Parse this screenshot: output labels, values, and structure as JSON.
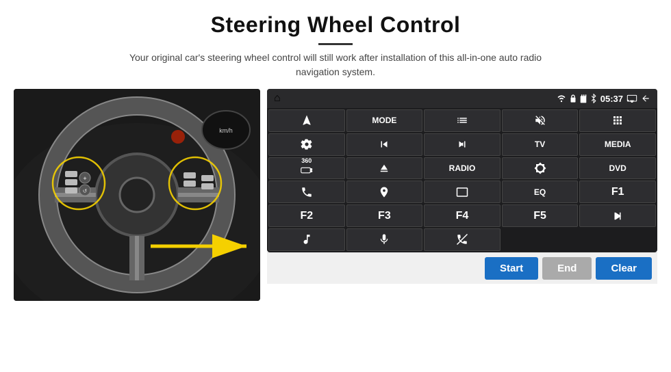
{
  "header": {
    "title": "Steering Wheel Control",
    "description": "Your original car's steering wheel control will still work after installation of this all-in-one auto radio navigation system."
  },
  "status_bar": {
    "home_icon": "⌂",
    "wifi_icon": "wifi",
    "lock_icon": "lock",
    "sd_icon": "sd",
    "bt_icon": "bt",
    "time": "05:37",
    "cast_icon": "cast",
    "back_icon": "back"
  },
  "buttons": [
    {
      "id": "nav",
      "type": "icon",
      "icon": "nav",
      "row": 1,
      "col": 1
    },
    {
      "id": "mode",
      "type": "text",
      "label": "MODE",
      "row": 1,
      "col": 2
    },
    {
      "id": "list",
      "type": "icon",
      "icon": "list",
      "row": 1,
      "col": 3
    },
    {
      "id": "mute",
      "type": "icon",
      "icon": "mute",
      "row": 1,
      "col": 4
    },
    {
      "id": "apps",
      "type": "icon",
      "icon": "apps",
      "row": 1,
      "col": 5
    },
    {
      "id": "settings",
      "type": "icon",
      "icon": "settings",
      "row": 2,
      "col": 1
    },
    {
      "id": "prev",
      "type": "icon",
      "icon": "prev",
      "row": 2,
      "col": 2
    },
    {
      "id": "next",
      "type": "icon",
      "icon": "next",
      "row": 2,
      "col": 3
    },
    {
      "id": "tv",
      "type": "text",
      "label": "TV",
      "row": 2,
      "col": 4
    },
    {
      "id": "media",
      "type": "text",
      "label": "MEDIA",
      "row": 2,
      "col": 5
    },
    {
      "id": "cam360",
      "type": "icon",
      "icon": "360cam",
      "row": 3,
      "col": 1
    },
    {
      "id": "eject",
      "type": "icon",
      "icon": "eject",
      "row": 3,
      "col": 2
    },
    {
      "id": "radio",
      "type": "text",
      "label": "RADIO",
      "row": 3,
      "col": 3
    },
    {
      "id": "brightness",
      "type": "icon",
      "icon": "brightness",
      "row": 3,
      "col": 4
    },
    {
      "id": "dvd",
      "type": "text",
      "label": "DVD",
      "row": 3,
      "col": 5
    },
    {
      "id": "phone",
      "type": "icon",
      "icon": "phone",
      "row": 4,
      "col": 1
    },
    {
      "id": "map",
      "type": "icon",
      "icon": "map",
      "row": 4,
      "col": 2
    },
    {
      "id": "screen",
      "type": "icon",
      "icon": "screen",
      "row": 4,
      "col": 3
    },
    {
      "id": "eq",
      "type": "text",
      "label": "EQ",
      "row": 4,
      "col": 4
    },
    {
      "id": "f1",
      "type": "text",
      "label": "F1",
      "row": 4,
      "col": 5
    },
    {
      "id": "f2",
      "type": "text",
      "label": "F2",
      "row": 5,
      "col": 1
    },
    {
      "id": "f3",
      "type": "text",
      "label": "F3",
      "row": 5,
      "col": 2
    },
    {
      "id": "f4",
      "type": "text",
      "label": "F4",
      "row": 5,
      "col": 3
    },
    {
      "id": "f5",
      "type": "text",
      "label": "F5",
      "row": 5,
      "col": 4
    },
    {
      "id": "playpause",
      "type": "icon",
      "icon": "playpause",
      "row": 5,
      "col": 5
    },
    {
      "id": "music",
      "type": "icon",
      "icon": "music",
      "row": 6,
      "col": 1
    },
    {
      "id": "mic",
      "type": "icon",
      "icon": "mic",
      "row": 6,
      "col": 2
    },
    {
      "id": "phone2",
      "type": "icon",
      "icon": "phone2",
      "row": 6,
      "col": 3
    }
  ],
  "bottom_buttons": {
    "start": "Start",
    "end": "End",
    "clear": "Clear"
  }
}
